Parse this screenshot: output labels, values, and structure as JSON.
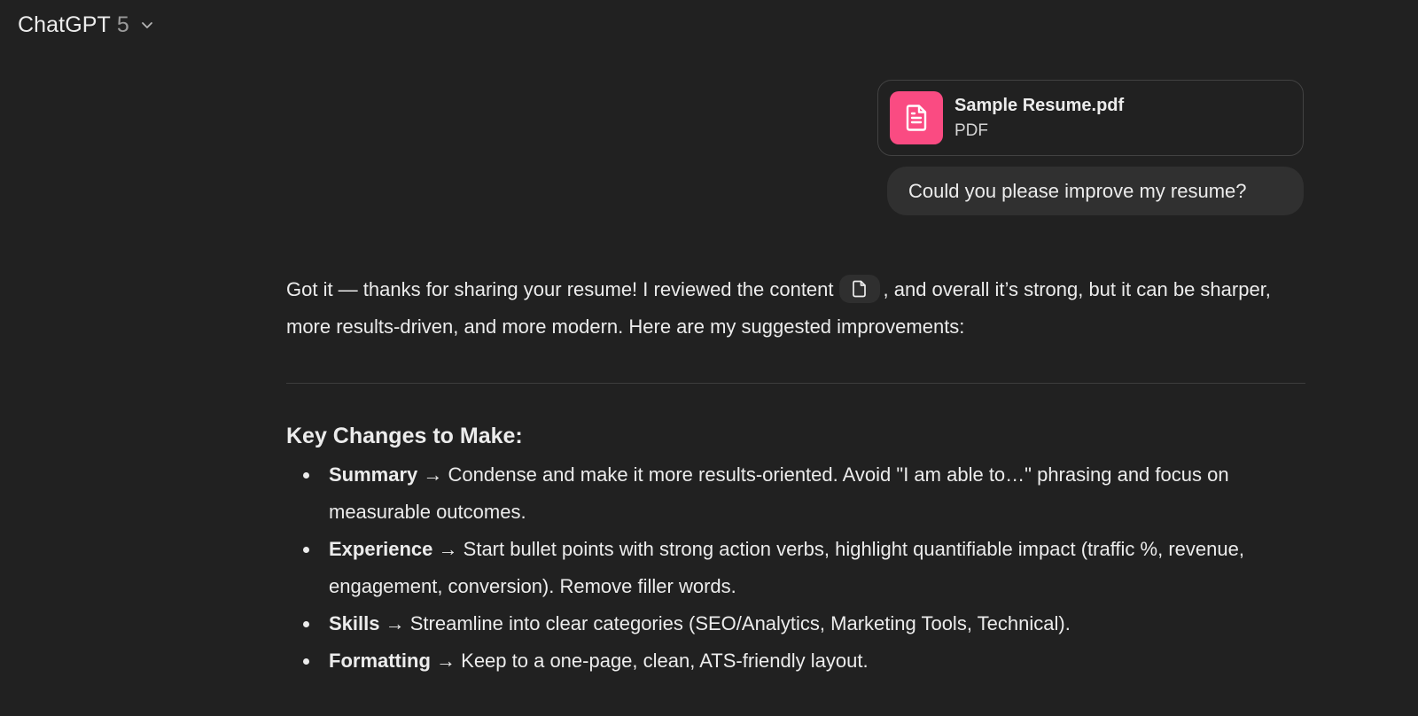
{
  "header": {
    "model_name": "ChatGPT",
    "model_version": "5"
  },
  "user": {
    "attachment": {
      "file_name": "Sample Resume.pdf",
      "file_type": "PDF",
      "icon": "document-icon",
      "icon_bg": "#fa4b82"
    },
    "message": "Could you please improve my resume?"
  },
  "assistant": {
    "intro_part1": "Got it — thanks for sharing your resume! I reviewed the content",
    "intro_part2": ", and overall it’s strong, but it can be sharper, more results-driven, and more modern. Here are my suggested improvements:",
    "section_title": "Key Changes to Make:",
    "arrow": "→",
    "changes": [
      {
        "label": "Summary",
        "text": "Condense and make it more results-oriented. Avoid \"I am able to…\" phrasing and focus on measurable outcomes."
      },
      {
        "label": "Experience",
        "text": "Start bullet points with strong action verbs, highlight quantifiable impact (traffic %, revenue, engagement, conversion). Remove filler words."
      },
      {
        "label": "Skills",
        "text": "Streamline into clear categories (SEO/Analytics, Marketing Tools, Technical)."
      },
      {
        "label": "Formatting",
        "text": "Keep to a one-page, clean, ATS-friendly layout."
      }
    ]
  },
  "colors": {
    "background": "#212121",
    "bubble": "#303030",
    "text": "#ececec",
    "muted": "#9b9b9b"
  }
}
